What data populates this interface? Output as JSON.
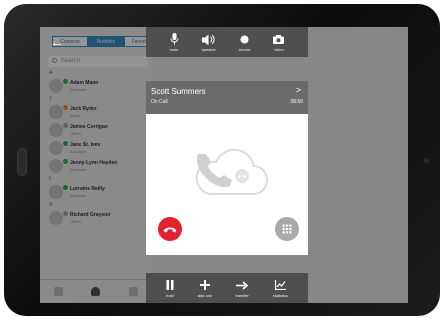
{
  "contacts": {
    "tabs": [
      "Contacts",
      "Buddies",
      "Favorites"
    ],
    "active_tab": 1,
    "search_placeholder": "Search",
    "sections": [
      {
        "letter": "A",
        "rows": [
          {
            "name": "Adam Mann",
            "sub": "Available",
            "status": "online"
          }
        ]
      },
      {
        "letter": "J",
        "rows": [
          {
            "name": "Jack Ryder",
            "sub": "Away",
            "status": "away"
          },
          {
            "name": "James Corrigan",
            "sub": "Offline",
            "status": "offline"
          },
          {
            "name": "Jane St. Ives",
            "sub": "Available",
            "status": "online"
          },
          {
            "name": "Jenny-Lynn Hayden",
            "sub": "Available",
            "status": "online"
          }
        ]
      },
      {
        "letter": "L",
        "rows": [
          {
            "name": "Lorraine Reilly",
            "sub": "Available",
            "status": "online"
          }
        ]
      },
      {
        "letter": "R",
        "rows": [
          {
            "name": "Richard Grayson",
            "sub": "Offline",
            "status": "offline"
          }
        ]
      }
    ]
  },
  "top_controls": [
    {
      "icon": "microphone-icon",
      "label": "mute"
    },
    {
      "icon": "speaker-icon",
      "label": "speaker"
    },
    {
      "icon": "record-icon",
      "label": "record"
    },
    {
      "icon": "camera-icon",
      "label": "video"
    }
  ],
  "call": {
    "caller_name": "Scott Summers",
    "status": "On Call",
    "timer": "08:50",
    "chevron": ">",
    "hangup_color": "#e1232d",
    "watermark_icon": "phone-cloud-icon"
  },
  "bottom_controls": [
    {
      "icon": "pause-icon",
      "label": "hold"
    },
    {
      "icon": "plus-icon",
      "label": "add call"
    },
    {
      "icon": "transfer-arrow-icon",
      "label": "transfer"
    },
    {
      "icon": "chart-icon",
      "label": "statistics"
    }
  ]
}
